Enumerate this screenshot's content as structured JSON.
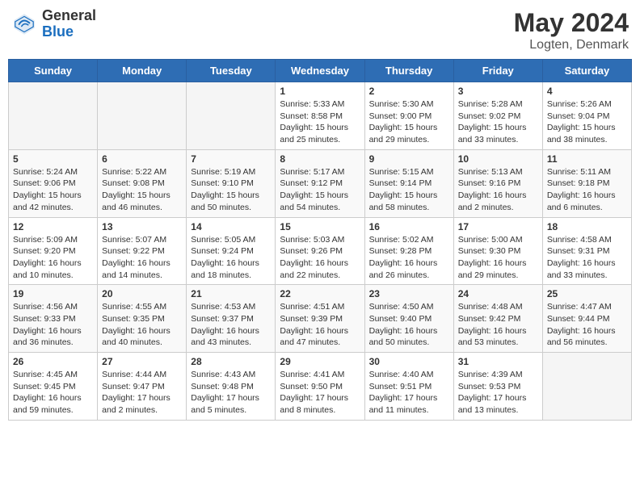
{
  "header": {
    "logo_general": "General",
    "logo_blue": "Blue",
    "title": "May 2024",
    "location": "Logten, Denmark"
  },
  "days_of_week": [
    "Sunday",
    "Monday",
    "Tuesday",
    "Wednesday",
    "Thursday",
    "Friday",
    "Saturday"
  ],
  "weeks": [
    [
      {
        "day": "",
        "info": ""
      },
      {
        "day": "",
        "info": ""
      },
      {
        "day": "",
        "info": ""
      },
      {
        "day": "1",
        "info": "Sunrise: 5:33 AM\nSunset: 8:58 PM\nDaylight: 15 hours\nand 25 minutes."
      },
      {
        "day": "2",
        "info": "Sunrise: 5:30 AM\nSunset: 9:00 PM\nDaylight: 15 hours\nand 29 minutes."
      },
      {
        "day": "3",
        "info": "Sunrise: 5:28 AM\nSunset: 9:02 PM\nDaylight: 15 hours\nand 33 minutes."
      },
      {
        "day": "4",
        "info": "Sunrise: 5:26 AM\nSunset: 9:04 PM\nDaylight: 15 hours\nand 38 minutes."
      }
    ],
    [
      {
        "day": "5",
        "info": "Sunrise: 5:24 AM\nSunset: 9:06 PM\nDaylight: 15 hours\nand 42 minutes."
      },
      {
        "day": "6",
        "info": "Sunrise: 5:22 AM\nSunset: 9:08 PM\nDaylight: 15 hours\nand 46 minutes."
      },
      {
        "day": "7",
        "info": "Sunrise: 5:19 AM\nSunset: 9:10 PM\nDaylight: 15 hours\nand 50 minutes."
      },
      {
        "day": "8",
        "info": "Sunrise: 5:17 AM\nSunset: 9:12 PM\nDaylight: 15 hours\nand 54 minutes."
      },
      {
        "day": "9",
        "info": "Sunrise: 5:15 AM\nSunset: 9:14 PM\nDaylight: 15 hours\nand 58 minutes."
      },
      {
        "day": "10",
        "info": "Sunrise: 5:13 AM\nSunset: 9:16 PM\nDaylight: 16 hours\nand 2 minutes."
      },
      {
        "day": "11",
        "info": "Sunrise: 5:11 AM\nSunset: 9:18 PM\nDaylight: 16 hours\nand 6 minutes."
      }
    ],
    [
      {
        "day": "12",
        "info": "Sunrise: 5:09 AM\nSunset: 9:20 PM\nDaylight: 16 hours\nand 10 minutes."
      },
      {
        "day": "13",
        "info": "Sunrise: 5:07 AM\nSunset: 9:22 PM\nDaylight: 16 hours\nand 14 minutes."
      },
      {
        "day": "14",
        "info": "Sunrise: 5:05 AM\nSunset: 9:24 PM\nDaylight: 16 hours\nand 18 minutes."
      },
      {
        "day": "15",
        "info": "Sunrise: 5:03 AM\nSunset: 9:26 PM\nDaylight: 16 hours\nand 22 minutes."
      },
      {
        "day": "16",
        "info": "Sunrise: 5:02 AM\nSunset: 9:28 PM\nDaylight: 16 hours\nand 26 minutes."
      },
      {
        "day": "17",
        "info": "Sunrise: 5:00 AM\nSunset: 9:30 PM\nDaylight: 16 hours\nand 29 minutes."
      },
      {
        "day": "18",
        "info": "Sunrise: 4:58 AM\nSunset: 9:31 PM\nDaylight: 16 hours\nand 33 minutes."
      }
    ],
    [
      {
        "day": "19",
        "info": "Sunrise: 4:56 AM\nSunset: 9:33 PM\nDaylight: 16 hours\nand 36 minutes."
      },
      {
        "day": "20",
        "info": "Sunrise: 4:55 AM\nSunset: 9:35 PM\nDaylight: 16 hours\nand 40 minutes."
      },
      {
        "day": "21",
        "info": "Sunrise: 4:53 AM\nSunset: 9:37 PM\nDaylight: 16 hours\nand 43 minutes."
      },
      {
        "day": "22",
        "info": "Sunrise: 4:51 AM\nSunset: 9:39 PM\nDaylight: 16 hours\nand 47 minutes."
      },
      {
        "day": "23",
        "info": "Sunrise: 4:50 AM\nSunset: 9:40 PM\nDaylight: 16 hours\nand 50 minutes."
      },
      {
        "day": "24",
        "info": "Sunrise: 4:48 AM\nSunset: 9:42 PM\nDaylight: 16 hours\nand 53 minutes."
      },
      {
        "day": "25",
        "info": "Sunrise: 4:47 AM\nSunset: 9:44 PM\nDaylight: 16 hours\nand 56 minutes."
      }
    ],
    [
      {
        "day": "26",
        "info": "Sunrise: 4:45 AM\nSunset: 9:45 PM\nDaylight: 16 hours\nand 59 minutes."
      },
      {
        "day": "27",
        "info": "Sunrise: 4:44 AM\nSunset: 9:47 PM\nDaylight: 17 hours\nand 2 minutes."
      },
      {
        "day": "28",
        "info": "Sunrise: 4:43 AM\nSunset: 9:48 PM\nDaylight: 17 hours\nand 5 minutes."
      },
      {
        "day": "29",
        "info": "Sunrise: 4:41 AM\nSunset: 9:50 PM\nDaylight: 17 hours\nand 8 minutes."
      },
      {
        "day": "30",
        "info": "Sunrise: 4:40 AM\nSunset: 9:51 PM\nDaylight: 17 hours\nand 11 minutes."
      },
      {
        "day": "31",
        "info": "Sunrise: 4:39 AM\nSunset: 9:53 PM\nDaylight: 17 hours\nand 13 minutes."
      },
      {
        "day": "",
        "info": ""
      }
    ]
  ]
}
